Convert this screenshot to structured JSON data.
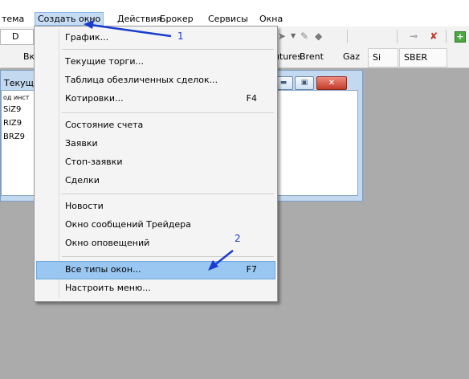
{
  "menubar": {
    "items": [
      {
        "label": "тема"
      },
      {
        "label": "Создать окно"
      },
      {
        "label": "Действия"
      },
      {
        "label": "Брокер"
      },
      {
        "label": "Сервисы"
      },
      {
        "label": "Окна"
      }
    ]
  },
  "toolbar": {
    "combo_value": "D"
  },
  "tabs": [
    {
      "label": "Вкл"
    },
    {
      "label": "utures"
    },
    {
      "label": "Brent"
    },
    {
      "label": "Gaz"
    },
    {
      "label": "Si"
    },
    {
      "label": "SBER"
    }
  ],
  "window": {
    "title": "Текущ",
    "rows": [
      {
        "text": "од инст"
      },
      {
        "text": "SiZ9"
      },
      {
        "text": "RIZ9"
      },
      {
        "text": "BRZ9"
      }
    ]
  },
  "dropdown": {
    "groups": [
      [
        {
          "label": "График...",
          "shortcut": ""
        },
        {
          "label": "Текущие торги...",
          "shortcut": ""
        },
        {
          "label": "Таблица обезличенных сделок...",
          "shortcut": ""
        },
        {
          "label": "Котировки...",
          "shortcut": "F4"
        }
      ],
      [
        {
          "label": "Состояние счета",
          "shortcut": ""
        },
        {
          "label": "Заявки",
          "shortcut": ""
        },
        {
          "label": "Стоп-заявки",
          "shortcut": ""
        },
        {
          "label": "Сделки",
          "shortcut": ""
        }
      ],
      [
        {
          "label": "Новости",
          "shortcut": ""
        },
        {
          "label": "Окно сообщений Трейдера",
          "shortcut": ""
        },
        {
          "label": "Окно оповещений",
          "shortcut": ""
        }
      ],
      [
        {
          "label": "Все типы окон...",
          "shortcut": "F7"
        },
        {
          "label": "Настроить меню...",
          "shortcut": ""
        }
      ]
    ]
  },
  "annotations": {
    "label1": "1",
    "label2": "2"
  },
  "colors": {
    "highlight": "#99c7f1",
    "arrow": "#1a3ccf",
    "workspace": "#ababab"
  }
}
